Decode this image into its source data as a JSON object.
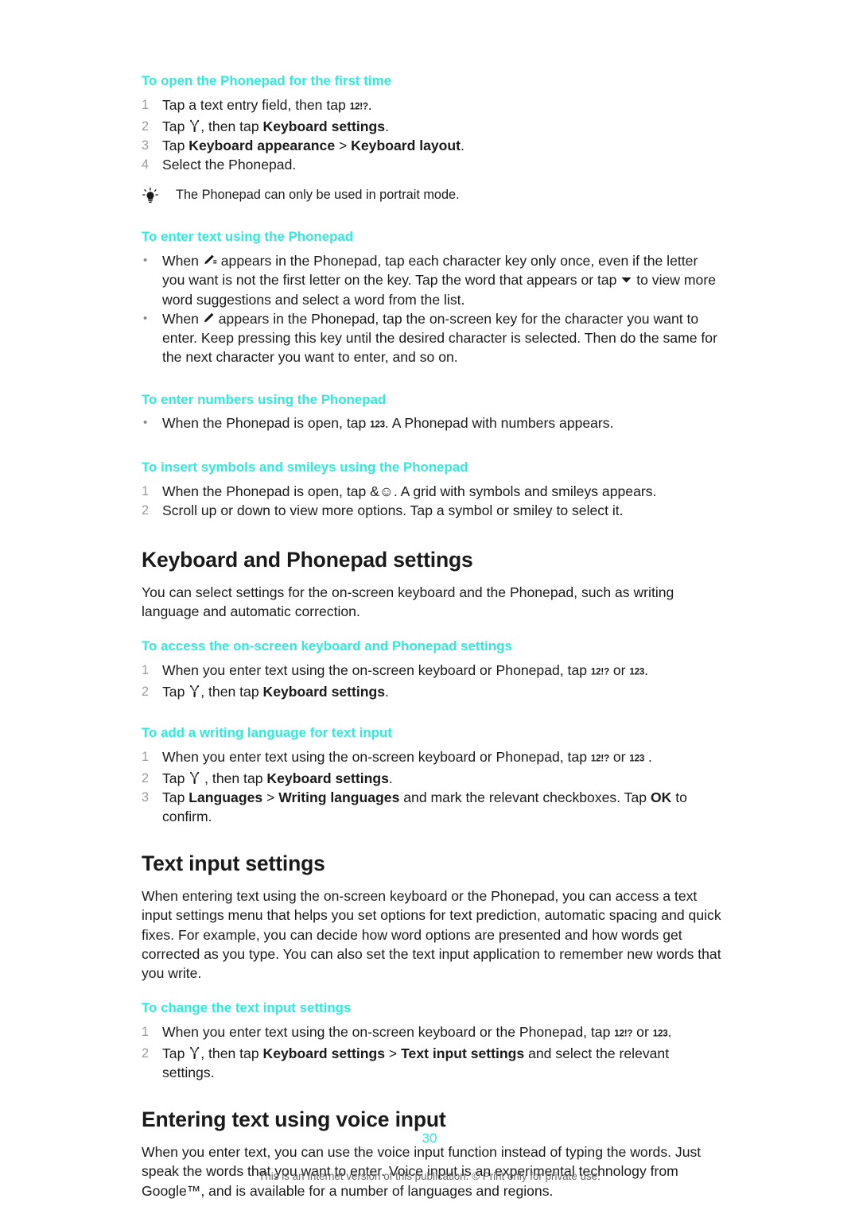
{
  "document": {
    "page_number": "30",
    "footer_note": "This is an Internet version of this publication. © Print only for private use."
  },
  "icons": {
    "key_12_symbols": "12!?",
    "key_123": "123",
    "key_amp_smiley": "&☺",
    "wrench": "wrench-icon",
    "pencil_quick": "pencil-dashes-icon",
    "pencil": "pencil-icon",
    "arrow_down": "triangle-down-icon",
    "bulb": "light-bulb-icon"
  },
  "sections": {
    "open_phonepad": {
      "heading": "To open the Phonepad for the first time",
      "steps": [
        {
          "num": "1",
          "pre": "Tap a text entry field, then tap ",
          "key": "12!?",
          "post": "."
        },
        {
          "num": "2",
          "pre": "Tap ",
          "mid": ", then tap ",
          "bold": "Keyboard settings",
          "post": "."
        },
        {
          "num": "3",
          "pre": "Tap ",
          "bold1": "Keyboard appearance",
          "sep": " > ",
          "bold2": "Keyboard layout",
          "post": "."
        },
        {
          "num": "4",
          "text": "Select the Phonepad."
        }
      ],
      "tip": "The Phonepad can only be used in portrait mode."
    },
    "enter_text": {
      "heading": "To enter text using the Phonepad",
      "bullets": [
        {
          "p1": "When ",
          "p2": " appears in the Phonepad, tap each character key only once, even if the letter you want is not the first letter on the key. Tap the word that appears or tap ",
          "p3": " to view more word suggestions and select a word from the list."
        },
        {
          "p1": "When ",
          "p2": " appears in the Phonepad, tap the on-screen key for the character you want to enter. Keep pressing this key until the desired character is selected. Then do the same for the next character you want to enter, and so on."
        }
      ]
    },
    "enter_numbers": {
      "heading": "To enter numbers using the Phonepad",
      "bullet": {
        "pre": "When the Phonepad is open, tap ",
        "key": "123",
        "post": ". A Phonepad with numbers appears."
      }
    },
    "insert_symbols": {
      "heading": "To insert symbols and smileys using the Phonepad",
      "steps": [
        {
          "num": "1",
          "pre": "When the Phonepad is open, tap ",
          "key": "&☺",
          "post": ". A grid with symbols and smileys appears."
        },
        {
          "num": "2",
          "text": "Scroll up or down to view more options. Tap a symbol or smiley to select it."
        }
      ]
    },
    "keyboard_phonepad_settings": {
      "title": "Keyboard and Phonepad settings",
      "intro": "You can select settings for the on-screen keyboard and the Phonepad, such as writing language and automatic correction.",
      "access": {
        "heading": "To access the on-screen keyboard and Phonepad settings",
        "steps": [
          {
            "num": "1",
            "pre": "When you enter text using the on-screen keyboard or Phonepad, tap ",
            "key1": "12!?",
            "mid": " or ",
            "key2": "123",
            "post": "."
          },
          {
            "num": "2",
            "pre": "Tap ",
            "mid": ", then tap ",
            "bold": "Keyboard settings",
            "post": "."
          }
        ]
      },
      "add_language": {
        "heading": "To add a writing language for text input",
        "steps": [
          {
            "num": "1",
            "pre": "When you enter text using the on-screen keyboard or Phonepad, tap ",
            "key1": "12!?",
            "mid": " or ",
            "key2": "123",
            "post": " ."
          },
          {
            "num": "2",
            "pre": "Tap ",
            "mid": " , then tap ",
            "bold": "Keyboard settings",
            "post": "."
          },
          {
            "num": "3",
            "pre": "Tap ",
            "bold1": "Languages",
            "sep": " > ",
            "bold2": "Writing languages",
            "mid": " and mark the relevant checkboxes. Tap ",
            "bold3": "OK",
            "post": " to confirm."
          }
        ]
      }
    },
    "text_input_settings": {
      "title": "Text input settings",
      "intro": "When entering text using the on-screen keyboard or the Phonepad, you can access a text input settings menu that helps you set options for text prediction, automatic spacing and quick fixes. For example, you can decide how word options are presented and how words get corrected as you type. You can also set the text input application to remember new words that you write.",
      "change": {
        "heading": "To change the text input settings",
        "steps": [
          {
            "num": "1",
            "pre": "When you enter text using the on-screen keyboard or the Phonepad, tap ",
            "key1": "12!?",
            "mid": " or ",
            "key2": "123",
            "post": "."
          },
          {
            "num": "2",
            "pre": "Tap ",
            "mid": ", then tap ",
            "bold1": "Keyboard settings",
            "sep": " > ",
            "bold2": "Text input settings",
            "post": " and select the relevant settings."
          }
        ]
      }
    },
    "voice_input": {
      "title": "Entering text using voice input",
      "intro": "When you enter text, you can use the voice input function instead of typing the words. Just speak the words that you want to enter. Voice input is an experimental technology from Google™, and is available for a number of languages and regions."
    }
  }
}
